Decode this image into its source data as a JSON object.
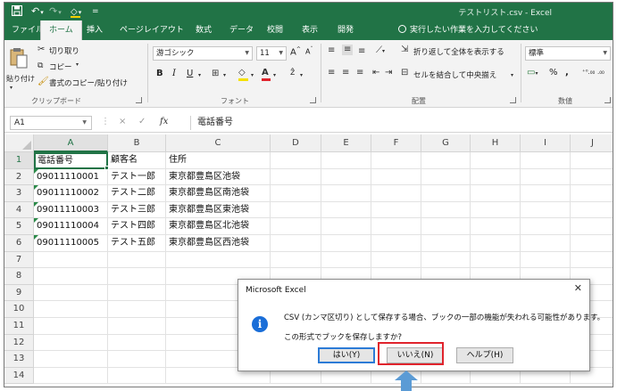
{
  "window": {
    "title": "テストリスト.csv - Excel",
    "accent_color": "#217346",
    "qat": {
      "save_icon": "save-icon",
      "undo_glyph": "↶",
      "redo_glyph": "↷",
      "paint_glyph": "🖌",
      "more_glyph": "="
    }
  },
  "tabs": [
    "ファイル",
    "ホーム",
    "挿入",
    "ページレイアウト",
    "数式",
    "データ",
    "校閲",
    "表示",
    "開発"
  ],
  "active_tab": "ホーム",
  "tell_me": "実行したい作業を入力してください",
  "ribbon": {
    "clipboard": {
      "paste": "貼り付け",
      "cut": "切り取り",
      "copy": "コピー",
      "format_painter": "書式のコピー/貼り付け",
      "label": "クリップボード"
    },
    "font": {
      "name": "游ゴシック",
      "size": "11",
      "bold": "B",
      "italic": "I",
      "underline": "U",
      "grow": "A",
      "shrink": "A",
      "label": "フォント"
    },
    "alignment": {
      "wrap_text": "折り返して全体を表示する",
      "merge_center": "セルを結合して中央揃え",
      "label": "配置"
    },
    "number": {
      "format": "標準",
      "percent": "%",
      "comma": ",",
      "label": "数値"
    }
  },
  "formula_bar": {
    "name_box": "A1",
    "fx": "fx",
    "cancel": "×",
    "enter": "✓",
    "content": "電話番号"
  },
  "columns": [
    "A",
    "B",
    "C",
    "D",
    "E",
    "F",
    "G",
    "H",
    "I",
    "J"
  ],
  "rows": [
    "1",
    "2",
    "3",
    "4",
    "5",
    "6",
    "7",
    "8",
    "9",
    "10",
    "11",
    "12",
    "13",
    "14"
  ],
  "cells": [
    [
      "電話番号",
      "顧客名",
      "住所"
    ],
    [
      "09011110001",
      "テスト一郎",
      "東京都豊島区池袋"
    ],
    [
      "09011110002",
      "テスト二郎",
      "東京都豊島区南池袋"
    ],
    [
      "09011110003",
      "テスト三郎",
      "東京都豊島区東池袋"
    ],
    [
      "09011110004",
      "テスト四郎",
      "東京都豊島区北池袋"
    ],
    [
      "09011110005",
      "テスト五郎",
      "東京都豊島区西池袋"
    ]
  ],
  "dialog": {
    "title": "Microsoft Excel",
    "icon": "info-icon",
    "message": "CSV (カンマ区切り) として保存する場合、ブックの一部の機能が失われる可能性があります。",
    "question": "この形式でブックを保存しますか?",
    "yes": "はい(Y)",
    "no": "いいえ(N)",
    "help": "ヘルプ(H)",
    "highlight_color": "#e0232c",
    "arrow_color": "#5b9bd5"
  }
}
